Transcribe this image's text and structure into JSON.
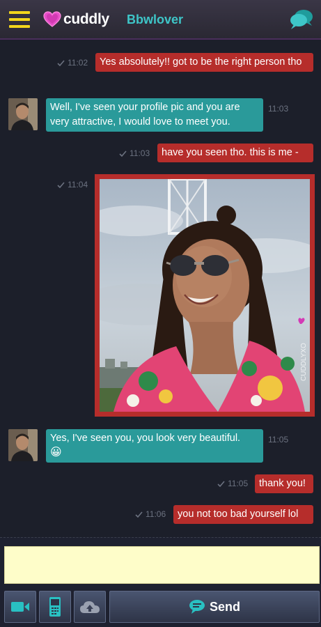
{
  "header": {
    "menu_icon": "hamburger-icon",
    "logo_text": "cuddly",
    "partner_name": "Bbwlover",
    "chat_icon": "chat-bubbles-icon",
    "accent_yellow": "#f2d51c",
    "accent_teal": "#3ec6c8"
  },
  "messages": [
    {
      "direction": "out",
      "time": "11:02",
      "text": "Yes absolutely!! got to be the right person tho"
    },
    {
      "direction": "in",
      "time": "11:03",
      "text": "Well, I've seen your profile pic and you are very attractive, I would love to meet you."
    },
    {
      "direction": "out",
      "time": "11:03",
      "text": "have you seen tho. this is me -"
    },
    {
      "direction": "out",
      "time": "11:04",
      "type": "photo"
    },
    {
      "direction": "in",
      "time": "11:05",
      "text": "Yes, I've seen you, you look very beautiful."
    },
    {
      "direction": "out",
      "time": "11:05",
      "text": "thank you!"
    },
    {
      "direction": "out",
      "time": "11:06",
      "text": "you not too bad yourself lol"
    }
  ],
  "emoji": "😀",
  "composer": {
    "input_value": "",
    "video_icon": "video-camera-icon",
    "phone_icon": "mobile-phone-icon",
    "upload_icon": "cloud-upload-icon",
    "send_label": "Send"
  },
  "colors": {
    "outgoing_bubble": "#b62d2b",
    "incoming_bubble": "#2a9a9a",
    "input_background": "#fefdc9"
  }
}
